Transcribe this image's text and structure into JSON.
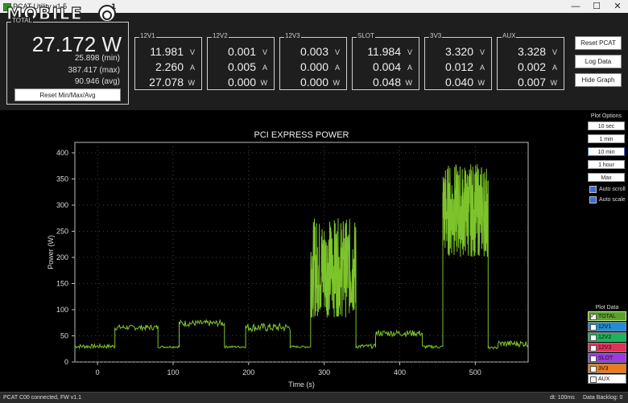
{
  "window": {
    "title": "PCAT Utility v1.5",
    "watermark": "MOBILE01",
    "controls": {
      "minimize": "—",
      "maximize": "☐",
      "close": "✕"
    }
  },
  "total": {
    "legend": "TOTAL",
    "power": "27.172 W",
    "min": "25.898 (min)",
    "max": "387.417 (max)",
    "avg": "90.946 (avg)",
    "reset_label": "Reset Min/Max/Avg"
  },
  "rails": [
    {
      "name": "12V1",
      "v": "11.981",
      "a": "2.260",
      "w": "27.078"
    },
    {
      "name": "12V2",
      "v": "0.001",
      "a": "0.005",
      "w": "0.000"
    },
    {
      "name": "12V3",
      "v": "0.003",
      "a": "0.000",
      "w": "0.000"
    },
    {
      "name": "SLOT",
      "v": "11.984",
      "a": "0.004",
      "w": "0.048"
    },
    {
      "name": "3V3",
      "v": "3.320",
      "a": "0.012",
      "w": "0.040"
    },
    {
      "name": "AUX",
      "v": "3.328",
      "a": "0.002",
      "w": "0.007"
    }
  ],
  "units": {
    "v": "V",
    "a": "A",
    "w": "W"
  },
  "actions": {
    "reset_pcat": "Reset PCAT",
    "log_data": "Log Data",
    "hide_graph": "Hide Graph"
  },
  "plot_options": {
    "title": "Plot Options",
    "ranges": [
      "10 sec",
      "1 min",
      "10 min",
      "1 hour",
      "Max"
    ],
    "selected_range": "10 min",
    "auto_scroll": "Auto scroll",
    "auto_scale": "Auto scale"
  },
  "plot_data": {
    "title": "Plot Data",
    "items": [
      {
        "label": "TOTAL",
        "color": "#7dc42c",
        "checked": true
      },
      {
        "label": "12V1",
        "color": "#1e8fd6",
        "checked": false
      },
      {
        "label": "12V2",
        "color": "#1fb25a",
        "checked": false
      },
      {
        "label": "12V3",
        "color": "#e0335a",
        "checked": false
      },
      {
        "label": "SLOT",
        "color": "#9b3be0",
        "checked": false
      },
      {
        "label": "3V3",
        "color": "#f07a1a",
        "checked": false
      },
      {
        "label": "AUX",
        "color": "#ffffff",
        "checked": false
      }
    ]
  },
  "status": {
    "connection": "PCAT C00 connected, FW v1.1",
    "dt": "dt: 100ms",
    "backlog": "Data Backlog: 0"
  },
  "chart_data": {
    "type": "line",
    "title": "PCI EXPRESS POWER",
    "xlabel": "Time (s)",
    "ylabel": "Power (W)",
    "xlim": [
      -30,
      570
    ],
    "ylim": [
      0,
      420
    ],
    "xticks": [
      0,
      100,
      200,
      300,
      400,
      500
    ],
    "yticks": [
      0,
      50,
      100,
      150,
      200,
      250,
      300,
      350,
      400
    ],
    "grid": true,
    "line_color": "#7dc42c",
    "series": [
      {
        "name": "TOTAL",
        "segments": [
          {
            "x0": -30,
            "x1": 23,
            "base": 30,
            "noise": 4
          },
          {
            "x0": 23,
            "x1": 80,
            "base": 66,
            "noise": 5
          },
          {
            "x0": 80,
            "x1": 108,
            "base": 29,
            "noise": 2
          },
          {
            "x0": 108,
            "x1": 168,
            "base": 74,
            "noise": 6
          },
          {
            "x0": 168,
            "x1": 196,
            "base": 29,
            "noise": 2
          },
          {
            "x0": 196,
            "x1": 255,
            "base": 66,
            "noise": 8
          },
          {
            "x0": 255,
            "x1": 282,
            "base": 29,
            "noise": 2
          },
          {
            "x0": 282,
            "x1": 342,
            "base": 180,
            "noise": 95
          },
          {
            "x0": 342,
            "x1": 368,
            "base": 30,
            "noise": 4
          },
          {
            "x0": 368,
            "x1": 430,
            "base": 55,
            "noise": 6
          },
          {
            "x0": 430,
            "x1": 457,
            "base": 29,
            "noise": 3
          },
          {
            "x0": 457,
            "x1": 517,
            "base": 290,
            "noise": 90
          },
          {
            "x0": 517,
            "x1": 530,
            "base": 27,
            "noise": 2
          },
          {
            "x0": 530,
            "x1": 570,
            "base": 35,
            "noise": 6
          }
        ]
      }
    ]
  }
}
